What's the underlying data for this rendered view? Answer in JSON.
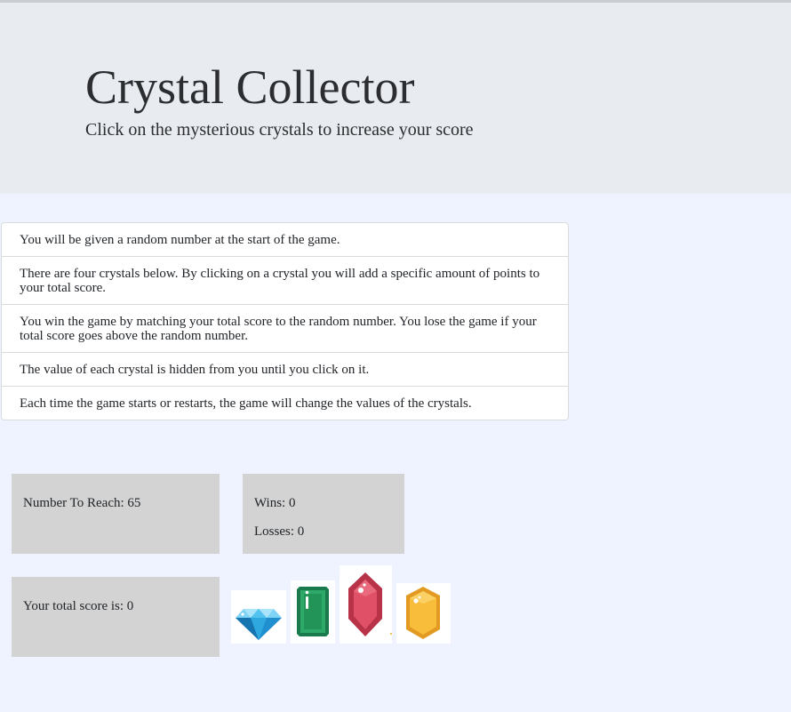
{
  "header": {
    "title": "Crystal Collector",
    "subtitle": "Click on the mysterious crystals to increase your score"
  },
  "rules": [
    "You will be given a random number at the start of the game.",
    "There are four crystals below. By clicking on a crystal you will add a specific amount of points to your total score.",
    "You win the game by matching your total score to the random number. You lose the game if your total score goes above the random number.",
    "The value of each crystal is hidden from you until you click on it.",
    "Each time the game starts or restarts, the game will change the values of the crystals."
  ],
  "game": {
    "target_text": "Number To Reach: 65",
    "target_value": 65,
    "wins_text": "Wins: 0",
    "losses_text": "Losses: 0",
    "score_text": "Your total score is: 0",
    "score_value": 0
  },
  "crystals": [
    {
      "icon": "blue-diamond-icon",
      "color": "#2fa8e0"
    },
    {
      "icon": "green-emerald-icon",
      "color": "#1f9159"
    },
    {
      "icon": "red-ruby-icon",
      "color": "#d9455a"
    },
    {
      "icon": "yellow-topaz-icon",
      "color": "#f4b93c"
    }
  ],
  "colors": {
    "page_background": "#eff3ff",
    "header_background": "#e8ebef",
    "panel_background": "#d3d3d3"
  }
}
